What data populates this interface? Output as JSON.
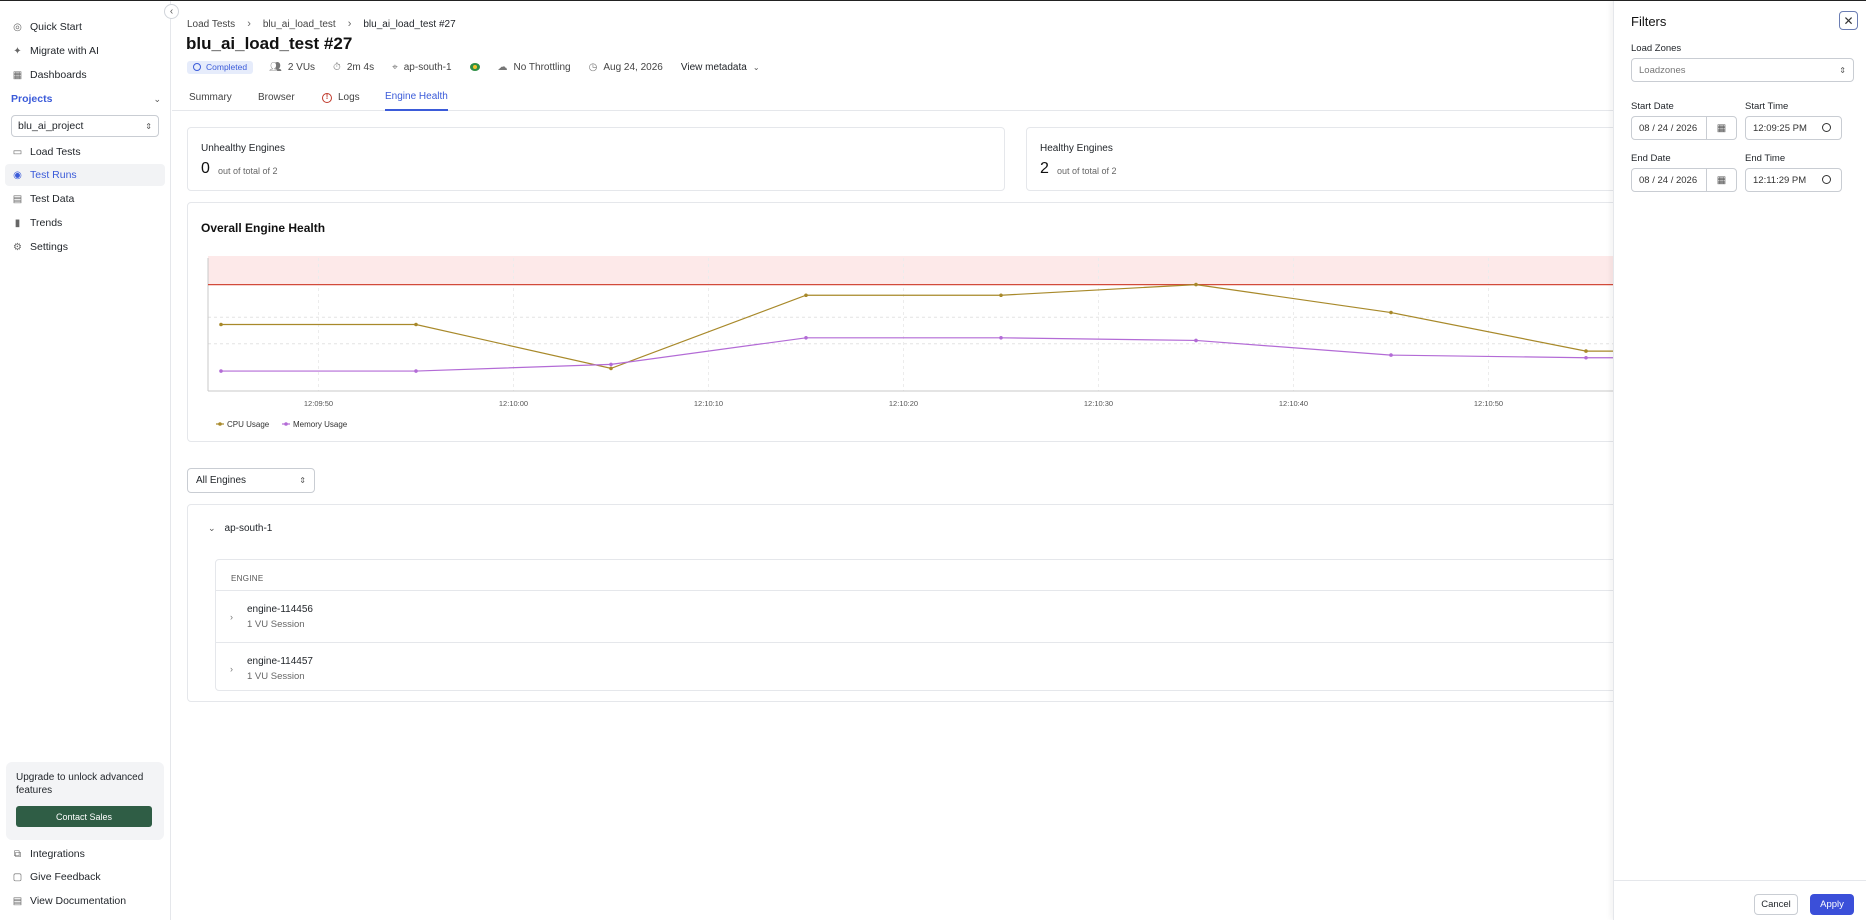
{
  "sidebar": {
    "items_top": [
      {
        "label": "Quick Start",
        "icon": "quick-start-icon"
      },
      {
        "label": "Migrate with AI",
        "icon": "sparkle-icon"
      },
      {
        "label": "Dashboards",
        "icon": "dashboard-icon"
      }
    ],
    "projects_label": "Projects",
    "project_selected": "blu_ai_project",
    "items_project": [
      {
        "label": "Load Tests",
        "icon": "load-tests-icon"
      },
      {
        "label": "Test Runs",
        "icon": "test-runs-icon"
      },
      {
        "label": "Test Data",
        "icon": "table-icon"
      },
      {
        "label": "Trends",
        "icon": "bar-chart-icon"
      },
      {
        "label": "Settings",
        "icon": "gear-icon"
      }
    ],
    "upgrade_text": "Upgrade to unlock advanced features",
    "contact_sales": "Contact Sales",
    "items_bottom": [
      {
        "label": "Integrations",
        "icon": "integrations-icon"
      },
      {
        "label": "Give Feedback",
        "icon": "feedback-icon"
      },
      {
        "label": "View Documentation",
        "icon": "docs-icon"
      }
    ]
  },
  "breadcrumb": [
    "Load Tests",
    "blu_ai_load_test",
    "blu_ai_load_test #27"
  ],
  "title": "blu_ai_load_test #27",
  "meta": {
    "status": "Completed",
    "vus": "2 VUs",
    "duration": "2m 4s",
    "region": "ap-south-1",
    "throttling": "No Throttling",
    "date": "Aug 24, 2026",
    "view_metadata": "View metadata"
  },
  "tabs": [
    "Summary",
    "Browser",
    "Logs",
    "Engine Health"
  ],
  "active_tab": "Engine Health",
  "cards": {
    "unhealthy": {
      "label": "Unhealthy Engines",
      "count": "0",
      "sub": "out of total of 2"
    },
    "healthy": {
      "label": "Healthy Engines",
      "count": "2",
      "sub": "out of total of 2"
    }
  },
  "chart_title": "Overall Engine Health",
  "chart_data": {
    "type": "line",
    "x": [
      "12:09:45",
      "12:09:55",
      "12:10:05",
      "12:10:15",
      "12:10:25",
      "12:10:35",
      "12:10:45",
      "12:10:55",
      "12:11:00"
    ],
    "x_ticks": [
      "12:09:50",
      "12:10:00",
      "12:10:10",
      "12:10:20",
      "12:10:30",
      "12:10:40",
      "12:10:50"
    ],
    "ylim": [
      0,
      100
    ],
    "threshold": 80,
    "series": [
      {
        "name": "CPU Usage",
        "color": "#a8892a",
        "values": [
          50,
          50,
          17,
          72,
          72,
          80,
          59,
          30,
          30
        ]
      },
      {
        "name": "Memory Usage",
        "color": "#b36bd6",
        "values": [
          15,
          15,
          20,
          40,
          40,
          38,
          27,
          25,
          25
        ]
      }
    ],
    "threshold_color": "#d24a3a",
    "grid": true,
    "legend": "bottom-left"
  },
  "engine_filter": "All Engines",
  "region_group": "ap-south-1",
  "table_header": "ENGINE",
  "engines": [
    {
      "name": "engine-114456",
      "session": "1 VU Session"
    },
    {
      "name": "engine-114457",
      "session": "1 VU Session"
    }
  ],
  "filters": {
    "title": "Filters",
    "load_zones_label": "Load Zones",
    "load_zones_placeholder": "Loadzones",
    "start_date_label": "Start Date",
    "start_date": "08 / 24 / 2026",
    "start_time_label": "Start Time",
    "start_time": "12:09:25 PM",
    "end_date_label": "End Date",
    "end_date": "08 / 24 / 2026",
    "end_time_label": "End Time",
    "end_time": "12:11:29 PM",
    "cancel": "Cancel",
    "apply": "Apply"
  }
}
